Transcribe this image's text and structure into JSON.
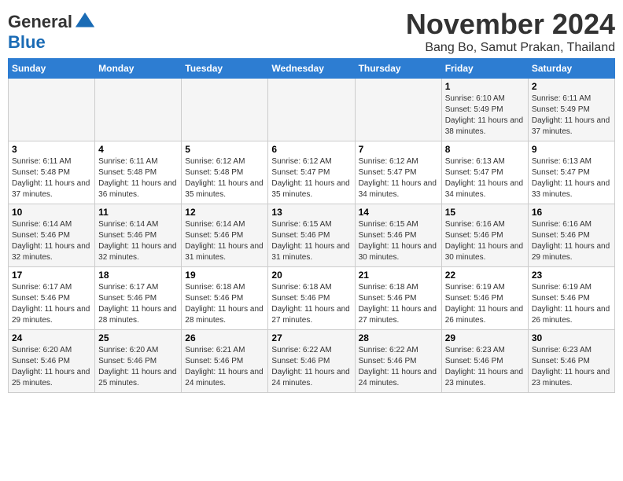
{
  "header": {
    "logo_line1": "General",
    "logo_line2": "Blue",
    "month": "November 2024",
    "location": "Bang Bo, Samut Prakan, Thailand"
  },
  "weekdays": [
    "Sunday",
    "Monday",
    "Tuesday",
    "Wednesday",
    "Thursday",
    "Friday",
    "Saturday"
  ],
  "weeks": [
    [
      {
        "day": "",
        "info": ""
      },
      {
        "day": "",
        "info": ""
      },
      {
        "day": "",
        "info": ""
      },
      {
        "day": "",
        "info": ""
      },
      {
        "day": "",
        "info": ""
      },
      {
        "day": "1",
        "info": "Sunrise: 6:10 AM\nSunset: 5:49 PM\nDaylight: 11 hours and 38 minutes."
      },
      {
        "day": "2",
        "info": "Sunrise: 6:11 AM\nSunset: 5:49 PM\nDaylight: 11 hours and 37 minutes."
      }
    ],
    [
      {
        "day": "3",
        "info": "Sunrise: 6:11 AM\nSunset: 5:48 PM\nDaylight: 11 hours and 37 minutes."
      },
      {
        "day": "4",
        "info": "Sunrise: 6:11 AM\nSunset: 5:48 PM\nDaylight: 11 hours and 36 minutes."
      },
      {
        "day": "5",
        "info": "Sunrise: 6:12 AM\nSunset: 5:48 PM\nDaylight: 11 hours and 35 minutes."
      },
      {
        "day": "6",
        "info": "Sunrise: 6:12 AM\nSunset: 5:47 PM\nDaylight: 11 hours and 35 minutes."
      },
      {
        "day": "7",
        "info": "Sunrise: 6:12 AM\nSunset: 5:47 PM\nDaylight: 11 hours and 34 minutes."
      },
      {
        "day": "8",
        "info": "Sunrise: 6:13 AM\nSunset: 5:47 PM\nDaylight: 11 hours and 34 minutes."
      },
      {
        "day": "9",
        "info": "Sunrise: 6:13 AM\nSunset: 5:47 PM\nDaylight: 11 hours and 33 minutes."
      }
    ],
    [
      {
        "day": "10",
        "info": "Sunrise: 6:14 AM\nSunset: 5:46 PM\nDaylight: 11 hours and 32 minutes."
      },
      {
        "day": "11",
        "info": "Sunrise: 6:14 AM\nSunset: 5:46 PM\nDaylight: 11 hours and 32 minutes."
      },
      {
        "day": "12",
        "info": "Sunrise: 6:14 AM\nSunset: 5:46 PM\nDaylight: 11 hours and 31 minutes."
      },
      {
        "day": "13",
        "info": "Sunrise: 6:15 AM\nSunset: 5:46 PM\nDaylight: 11 hours and 31 minutes."
      },
      {
        "day": "14",
        "info": "Sunrise: 6:15 AM\nSunset: 5:46 PM\nDaylight: 11 hours and 30 minutes."
      },
      {
        "day": "15",
        "info": "Sunrise: 6:16 AM\nSunset: 5:46 PM\nDaylight: 11 hours and 30 minutes."
      },
      {
        "day": "16",
        "info": "Sunrise: 6:16 AM\nSunset: 5:46 PM\nDaylight: 11 hours and 29 minutes."
      }
    ],
    [
      {
        "day": "17",
        "info": "Sunrise: 6:17 AM\nSunset: 5:46 PM\nDaylight: 11 hours and 29 minutes."
      },
      {
        "day": "18",
        "info": "Sunrise: 6:17 AM\nSunset: 5:46 PM\nDaylight: 11 hours and 28 minutes."
      },
      {
        "day": "19",
        "info": "Sunrise: 6:18 AM\nSunset: 5:46 PM\nDaylight: 11 hours and 28 minutes."
      },
      {
        "day": "20",
        "info": "Sunrise: 6:18 AM\nSunset: 5:46 PM\nDaylight: 11 hours and 27 minutes."
      },
      {
        "day": "21",
        "info": "Sunrise: 6:18 AM\nSunset: 5:46 PM\nDaylight: 11 hours and 27 minutes."
      },
      {
        "day": "22",
        "info": "Sunrise: 6:19 AM\nSunset: 5:46 PM\nDaylight: 11 hours and 26 minutes."
      },
      {
        "day": "23",
        "info": "Sunrise: 6:19 AM\nSunset: 5:46 PM\nDaylight: 11 hours and 26 minutes."
      }
    ],
    [
      {
        "day": "24",
        "info": "Sunrise: 6:20 AM\nSunset: 5:46 PM\nDaylight: 11 hours and 25 minutes."
      },
      {
        "day": "25",
        "info": "Sunrise: 6:20 AM\nSunset: 5:46 PM\nDaylight: 11 hours and 25 minutes."
      },
      {
        "day": "26",
        "info": "Sunrise: 6:21 AM\nSunset: 5:46 PM\nDaylight: 11 hours and 24 minutes."
      },
      {
        "day": "27",
        "info": "Sunrise: 6:22 AM\nSunset: 5:46 PM\nDaylight: 11 hours and 24 minutes."
      },
      {
        "day": "28",
        "info": "Sunrise: 6:22 AM\nSunset: 5:46 PM\nDaylight: 11 hours and 24 minutes."
      },
      {
        "day": "29",
        "info": "Sunrise: 6:23 AM\nSunset: 5:46 PM\nDaylight: 11 hours and 23 minutes."
      },
      {
        "day": "30",
        "info": "Sunrise: 6:23 AM\nSunset: 5:46 PM\nDaylight: 11 hours and 23 minutes."
      }
    ]
  ]
}
